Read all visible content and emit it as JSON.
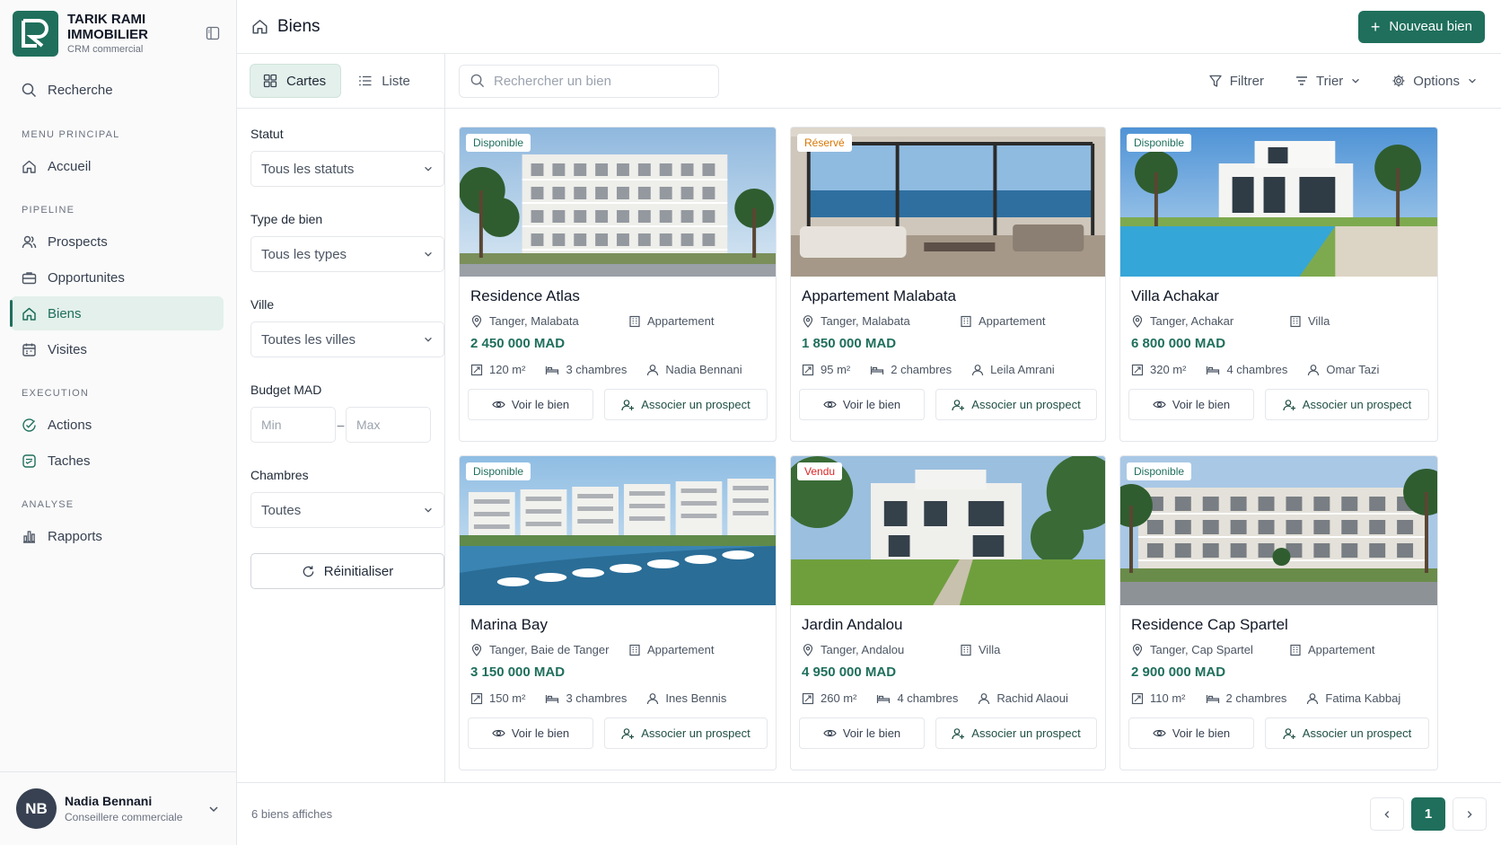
{
  "brand": {
    "name": "TARIK RAMI IMMOBILIER",
    "sub": "CRM commercial"
  },
  "sidebar": {
    "search_label": "Recherche",
    "sections": [
      {
        "title": "MENU PRINCIPAL",
        "items": [
          {
            "label": "Accueil",
            "icon": "home-icon"
          }
        ]
      },
      {
        "title": "PIPELINE",
        "items": [
          {
            "label": "Prospects",
            "icon": "users-icon"
          },
          {
            "label": "Opportunites",
            "icon": "briefcase-icon"
          },
          {
            "label": "Biens",
            "icon": "home-icon",
            "active": true
          },
          {
            "label": "Visites",
            "icon": "calendar-icon"
          }
        ]
      },
      {
        "title": "EXECUTION",
        "items": [
          {
            "label": "Actions",
            "icon": "check-circle-icon"
          },
          {
            "label": "Taches",
            "icon": "task-icon"
          }
        ]
      },
      {
        "title": "ANALYSE",
        "items": [
          {
            "label": "Rapports",
            "icon": "bar-chart-icon"
          }
        ]
      }
    ]
  },
  "user": {
    "initials": "NB",
    "name": "Nadia Bennani",
    "role": "Conseillere commerciale"
  },
  "header": {
    "title": "Biens",
    "new_button": "Nouveau bien"
  },
  "toolbar": {
    "view_cards": "Cartes",
    "view_list": "Liste",
    "search_placeholder": "Rechercher un bien",
    "filter": "Filtrer",
    "sort": "Trier",
    "options": "Options"
  },
  "filters": {
    "status_label": "Statut",
    "status_value": "Tous les statuts",
    "type_label": "Type de bien",
    "type_value": "Tous les types",
    "city_label": "Ville",
    "city_value": "Toutes les villes",
    "budget_label": "Budget MAD",
    "budget_min_placeholder": "Min",
    "budget_max_placeholder": "Max",
    "rooms_label": "Chambres",
    "rooms_value": "Toutes",
    "reset": "Réinitialiser"
  },
  "card_actions": {
    "view": "Voir le bien",
    "associate": "Associer un prospect"
  },
  "status_colors": {
    "Disponible": "#1f6f5c",
    "Réservé": "#d97706",
    "Vendu": "#dc2626"
  },
  "properties": [
    {
      "status": "Disponible",
      "title": "Residence Atlas",
      "location": "Tanger, Malabata",
      "type": "Appartement",
      "price": "2 450 000 MAD",
      "surface": "120 m²",
      "rooms": "3 chambres",
      "agent": "Nadia Bennani",
      "scene": "residence-building"
    },
    {
      "status": "Réservé",
      "title": "Appartement Malabata",
      "location": "Tanger, Malabata",
      "type": "Appartement",
      "price": "1 850 000 MAD",
      "surface": "95 m²",
      "rooms": "2 chambres",
      "agent": "Leila Amrani",
      "scene": "interior-sea-view"
    },
    {
      "status": "Disponible",
      "title": "Villa Achakar",
      "location": "Tanger, Achakar",
      "type": "Villa",
      "price": "6 800 000 MAD",
      "surface": "320 m²",
      "rooms": "4 chambres",
      "agent": "Omar Tazi",
      "scene": "villa-pool"
    },
    {
      "status": "Disponible",
      "title": "Marina Bay",
      "location": "Tanger, Baie de Tanger",
      "type": "Appartement",
      "price": "3 150 000 MAD",
      "surface": "150 m²",
      "rooms": "3 chambres",
      "agent": "Ines Bennis",
      "scene": "marina"
    },
    {
      "status": "Vendu",
      "title": "Jardin Andalou",
      "location": "Tanger, Andalou",
      "type": "Villa",
      "price": "4 950 000 MAD",
      "surface": "260 m²",
      "rooms": "4 chambres",
      "agent": "Rachid Alaoui",
      "scene": "villa-garden"
    },
    {
      "status": "Disponible",
      "title": "Residence Cap Spartel",
      "location": "Tanger, Cap Spartel",
      "type": "Appartement",
      "price": "2 900 000 MAD",
      "surface": "110 m²",
      "rooms": "2 chambres",
      "agent": "Fatima Kabbaj",
      "scene": "residence-street"
    }
  ],
  "footer": {
    "count": "6 biens affiches",
    "page": "1",
    "prev_icon": "chevron-left-icon",
    "next_icon": "chevron-right-icon"
  }
}
